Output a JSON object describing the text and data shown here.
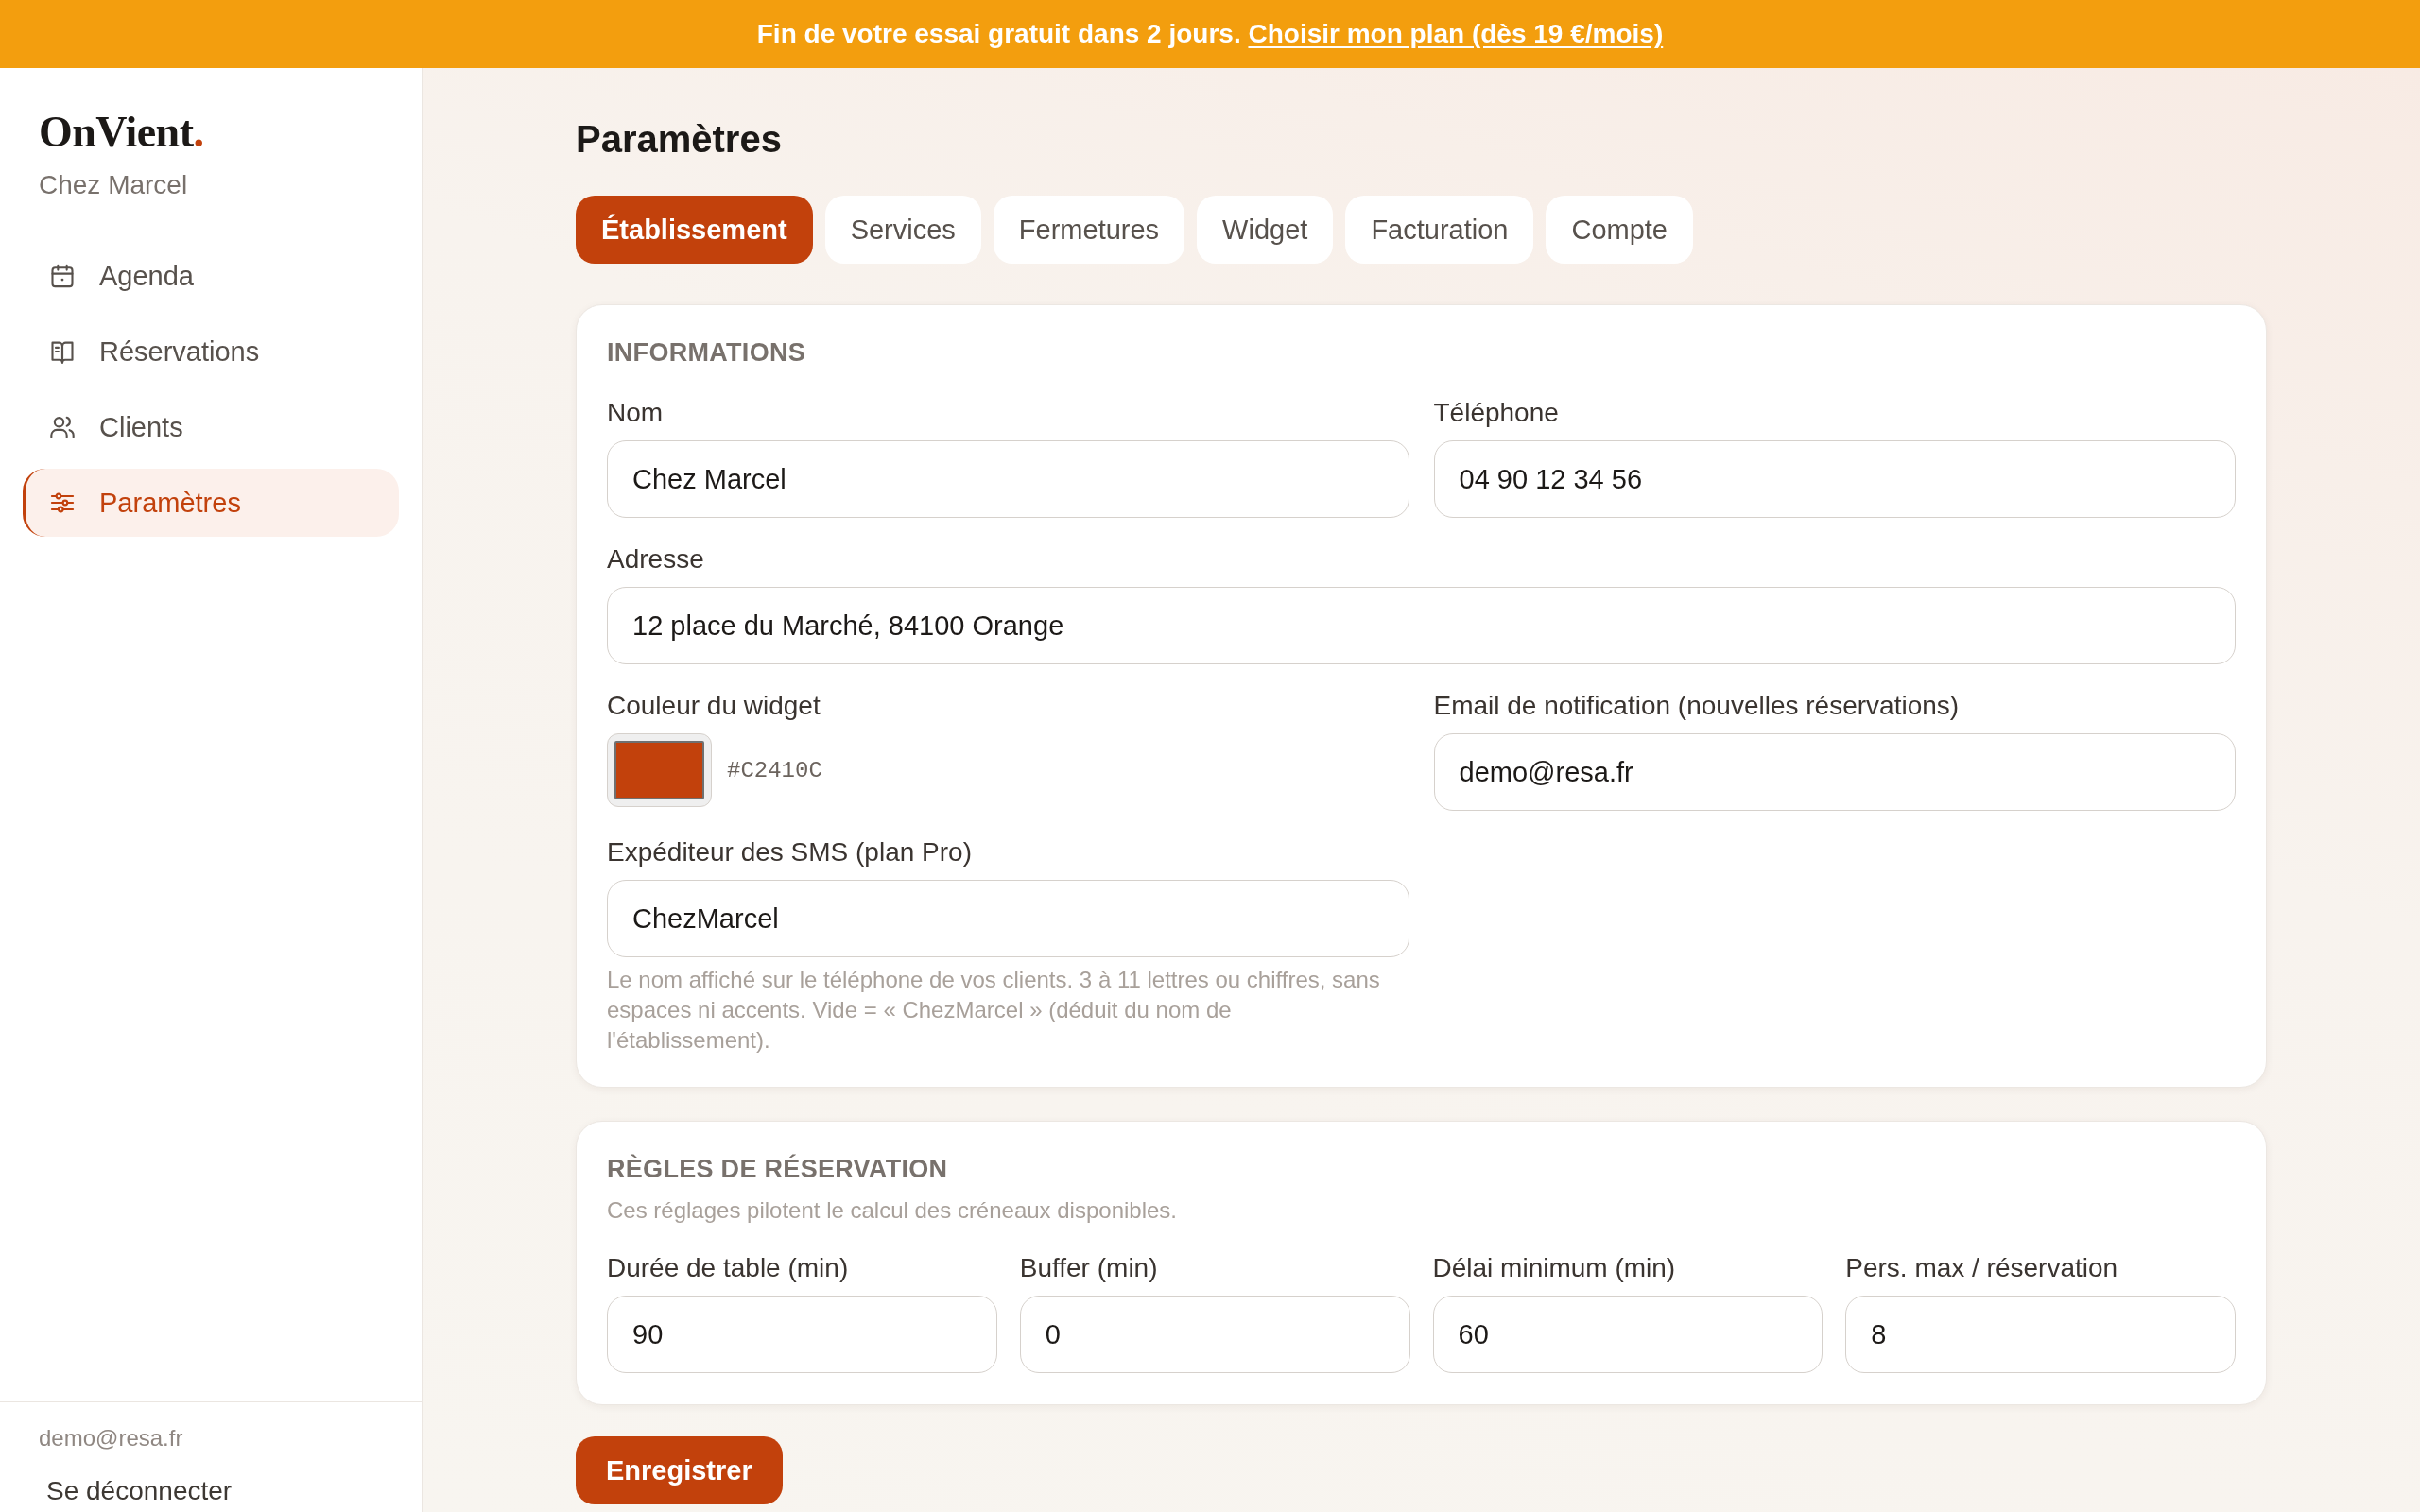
{
  "trial_banner": {
    "message": "Fin de votre essai gratuit dans 2 jours.",
    "link": "Choisir mon plan (dès 19 €/mois)"
  },
  "sidebar": {
    "logo": {
      "text": "OnVient",
      "accent": "."
    },
    "venue": "Chez Marcel",
    "items": [
      {
        "label": "Agenda",
        "selected": false
      },
      {
        "label": "Réservations",
        "selected": false
      },
      {
        "label": "Clients",
        "selected": false
      },
      {
        "label": "Paramètres",
        "selected": true
      }
    ],
    "account_email": "demo@resa.fr",
    "logout": "Se déconnecter"
  },
  "page": {
    "title": "Paramètres",
    "tabs": [
      {
        "label": "Établissement",
        "selected": true
      },
      {
        "label": "Services",
        "selected": false
      },
      {
        "label": "Fermetures",
        "selected": false
      },
      {
        "label": "Widget",
        "selected": false
      },
      {
        "label": "Facturation",
        "selected": false
      },
      {
        "label": "Compte",
        "selected": false
      }
    ],
    "informations": {
      "title": "INFORMATIONS",
      "fields": [
        {
          "kind": "text",
          "label": "Nom",
          "value": "Chez Marcel"
        },
        {
          "kind": "text",
          "label": "Téléphone",
          "value": "04 90 12 34 56"
        },
        {
          "kind": "address",
          "label": "Adresse",
          "value": "12 place du Marché, 84100 Orange"
        },
        {
          "kind": "color",
          "label": "Couleur du widget",
          "value": "#C2410C",
          "color": "#c2410c"
        },
        {
          "kind": "text",
          "label": "Email de notification (nouvelles réservations)",
          "value": "demo@resa.fr"
        },
        {
          "kind": "text",
          "label": "Expéditeur des SMS (plan Pro)",
          "value": "ChezMarcel",
          "help": "Le nom affiché sur le téléphone de vos clients. 3 à 11 lettres ou chiffres, sans espaces ni accents. Vide = « ChezMarcel » (déduit du nom de l'établissement)."
        }
      ]
    },
    "booking_rules": {
      "title": "RÈGLES DE RÉSERVATION",
      "subtitle": "Ces réglages pilotent le calcul des créneaux disponibles.",
      "fields": [
        {
          "label": "Durée de table (min)",
          "value": "90"
        },
        {
          "label": "Buffer (min)",
          "value": "0"
        },
        {
          "label": "Délai minimum (min)",
          "value": "60"
        },
        {
          "label": "Pers. max / réservation",
          "value": "8"
        }
      ]
    },
    "save_button": "Enregistrer"
  }
}
